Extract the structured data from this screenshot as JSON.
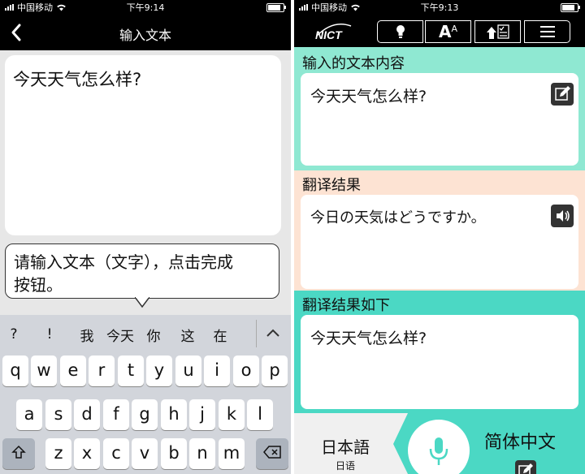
{
  "left": {
    "status": {
      "carrier": "中国移动",
      "time": "下午9:14"
    },
    "nav": {
      "title": "输入文本"
    },
    "input": {
      "text": "今天天气怎么样?"
    },
    "tooltip": {
      "line1": "请输入文本（文字），点击完成",
      "line2": "按钮。"
    },
    "candidates": [
      "?",
      "!",
      "我",
      "今天",
      "你",
      "这",
      "在"
    ],
    "keys": {
      "row1": [
        "q",
        "w",
        "e",
        "r",
        "t",
        "y",
        "u",
        "i",
        "o",
        "p"
      ],
      "row2": [
        "a",
        "s",
        "d",
        "f",
        "g",
        "h",
        "j",
        "k",
        "l"
      ],
      "row3": [
        "z",
        "x",
        "c",
        "v",
        "b",
        "n",
        "m"
      ]
    }
  },
  "right": {
    "status": {
      "carrier": "中国移动",
      "time": "下午9:13"
    },
    "logo": "NICT",
    "toolbar": {
      "font_size_label": "A",
      "font_size_sup": "A"
    },
    "input_section": {
      "header": "输入的文本内容",
      "text": "今天天气怎么样?"
    },
    "translation_section": {
      "header": "翻译结果",
      "text": "今日の天気はどうですか。"
    },
    "back_translation_section": {
      "header": "翻译结果如下",
      "text": "今天天气怎么样?"
    },
    "bottom": {
      "source_lang": "日本語",
      "source_lang_sub": "日语",
      "target_lang": "简体中文"
    }
  },
  "colors": {
    "input_bg": "#8fe8d2",
    "translation_bg": "#fde3d3",
    "back_bg": "#4bd8c4",
    "teal": "#4bd8c4",
    "keyboard": "#d2d5db"
  },
  "battery_level": 0.85
}
